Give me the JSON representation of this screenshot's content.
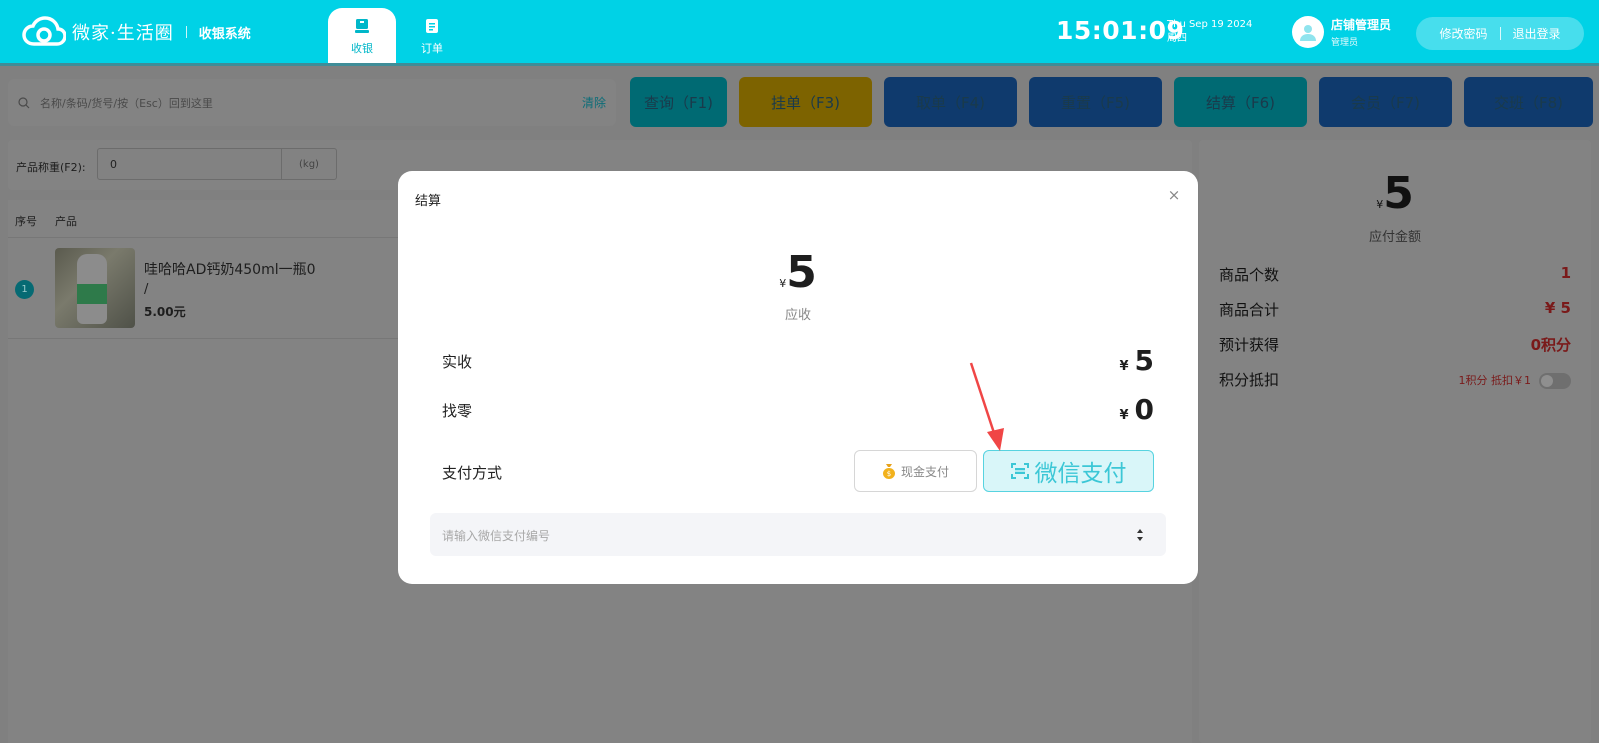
{
  "brand": {
    "name": "微家·生活圈",
    "system": "收银系统"
  },
  "nav": [
    {
      "label": "收银",
      "active": true
    },
    {
      "label": "订单",
      "active": false
    }
  ],
  "clock": {
    "time": "15:01:09",
    "date": "Thu Sep 19 2024",
    "weekday": "周四"
  },
  "user": {
    "name": "店铺管理员",
    "role": "管理员"
  },
  "account": {
    "change_password": "修改密码",
    "logout": "退出登录"
  },
  "search": {
    "placeholder": "名称/条码/货号/按（Esc）回到这里",
    "clear": "清除"
  },
  "actions": [
    {
      "label": "查询（F1)",
      "color": "teal"
    },
    {
      "label": "挂单（F3)",
      "color": "gold"
    },
    {
      "label": "取单（F4)",
      "color": "blue"
    },
    {
      "label": "重置（F5)",
      "color": "blue"
    },
    {
      "label": "结算（F6)",
      "color": "teal"
    },
    {
      "label": "会员（F7)",
      "color": "blue"
    },
    {
      "label": "交班（F8)",
      "color": "blue"
    }
  ],
  "weigh": {
    "label": "产品称重(F2):",
    "value": "0",
    "unit": "(kg)"
  },
  "list": {
    "columns": {
      "index": "序号",
      "product": "产品"
    },
    "items": [
      {
        "index": "1",
        "title": "哇哈哈AD钙奶450ml一瓶0",
        "spec": "/",
        "price": "5.00元"
      }
    ]
  },
  "summary": {
    "currency": "¥",
    "total": "5",
    "total_label": "应付金额",
    "rows": [
      {
        "label": "商品个数",
        "value": "1"
      },
      {
        "label": "商品合计",
        "value": "¥ 5"
      },
      {
        "label": "预计获得",
        "value": "0积分"
      },
      {
        "label": "积分抵扣",
        "value": "1积分 抵扣￥1"
      }
    ],
    "points_toggle_on": false
  },
  "modal": {
    "title": "结算",
    "close_glyph": "×",
    "currency": "¥",
    "amount": "5",
    "amount_label": "应收",
    "received_label": "实收",
    "received_value": "5",
    "change_label": "找零",
    "change_value": "0",
    "pay_method_label": "支付方式",
    "cash_label": "现金支付",
    "wechat_label": "微信支付",
    "selected_method": "wechat",
    "pay_code_placeholder": "请输入微信支付编号"
  },
  "colors": {
    "primary": "#00d2e6",
    "accent_red": "#e02020",
    "annotation_arrow": "#f04646"
  }
}
